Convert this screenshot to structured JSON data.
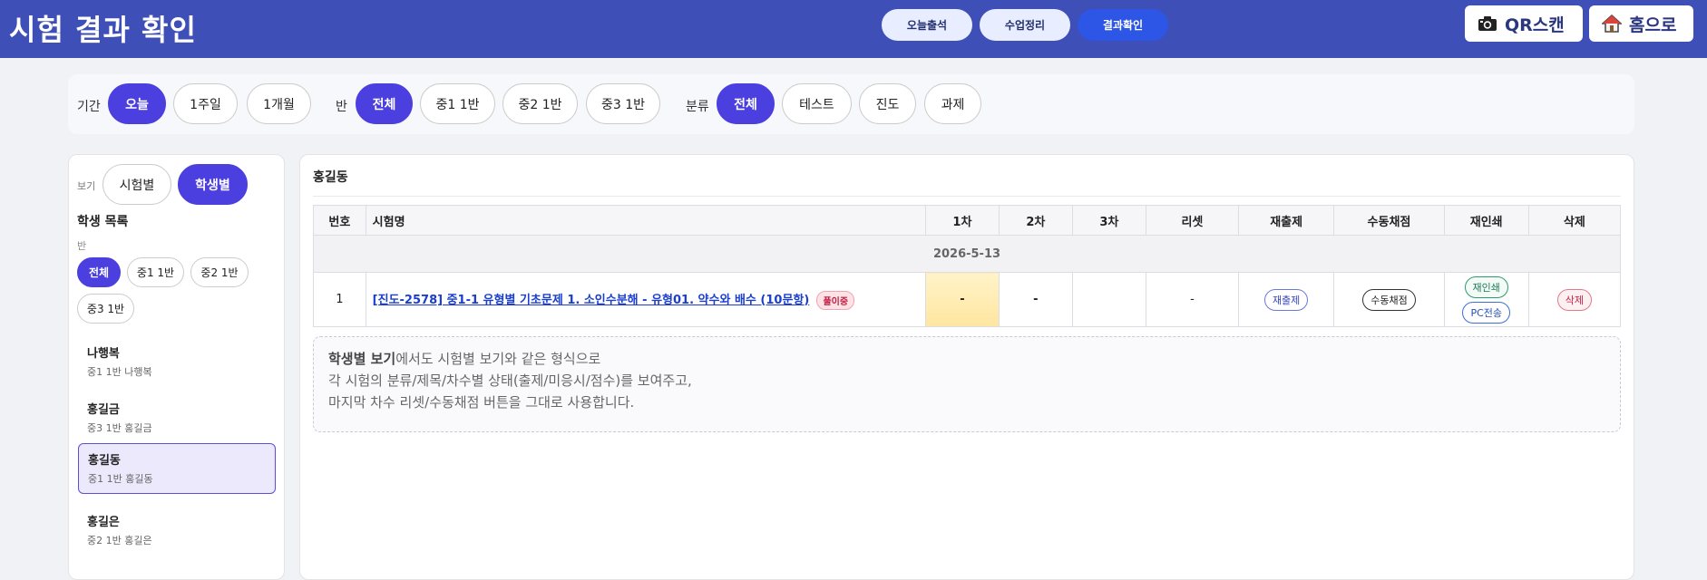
{
  "header": {
    "title": "시험 결과 확인",
    "nav": [
      {
        "label": "오늘출석",
        "active": false
      },
      {
        "label": "수업정리",
        "active": false
      },
      {
        "label": "결과확인",
        "active": true
      }
    ],
    "qr_label": "QR스캔",
    "home_label": "홈으로"
  },
  "filters": {
    "period_label": "기간",
    "period": [
      "오늘",
      "1주일",
      "1개월"
    ],
    "class_label": "반",
    "classes": [
      "전체",
      "중1 1반",
      "중2 1반",
      "중3 1반"
    ],
    "category_label": "분류",
    "categories": [
      "전체",
      "테스트",
      "진도",
      "과제"
    ]
  },
  "left": {
    "view_label": "보기",
    "view_exam": "시험별",
    "view_student": "학생별",
    "list_title": "학생 목록",
    "class_label": "반",
    "class_chips": [
      "전체",
      "중1 1반",
      "중2 1반",
      "중3 1반"
    ],
    "students": [
      {
        "name": "나행복",
        "sub": "중1 1반 나행복"
      },
      {
        "name": "홍길금",
        "sub": "중3 1반 홍길금"
      },
      {
        "name": "홍길동",
        "sub": "중1 1반 홍길동"
      },
      {
        "name": "홍길은",
        "sub": "중2 1반 홍길은"
      }
    ]
  },
  "main": {
    "title": "홍길동",
    "columns": [
      "번호",
      "시험명",
      "1차",
      "2차",
      "3차",
      "리셋",
      "재출제",
      "수동채점",
      "재인쇄",
      "삭제"
    ],
    "date": "2026-5-13",
    "row": {
      "no": "1",
      "exam": "[진도-2578] 중1-1 유형별 기초문제 1. 소인수분해 - 유형01. 약수와 배수 (10문항)",
      "status": "풀이중",
      "r1": "-",
      "r2": "-",
      "r3": "",
      "reset": "-",
      "reissue": "재출제",
      "manual": "수동채점",
      "reprint": "재인쇄",
      "pc": "PC전송",
      "delete": "삭제"
    },
    "note_bold": "학생별 보기",
    "note_line1": "에서도 시험별 보기와 같은 형식으로",
    "note_line2": "각 시험의 분류/제목/차수별 상태(출제/미응시/점수)를 보여주고,",
    "note_line3": "마지막 차수 리셋/수동채점 버튼을 그대로 사용합니다."
  }
}
